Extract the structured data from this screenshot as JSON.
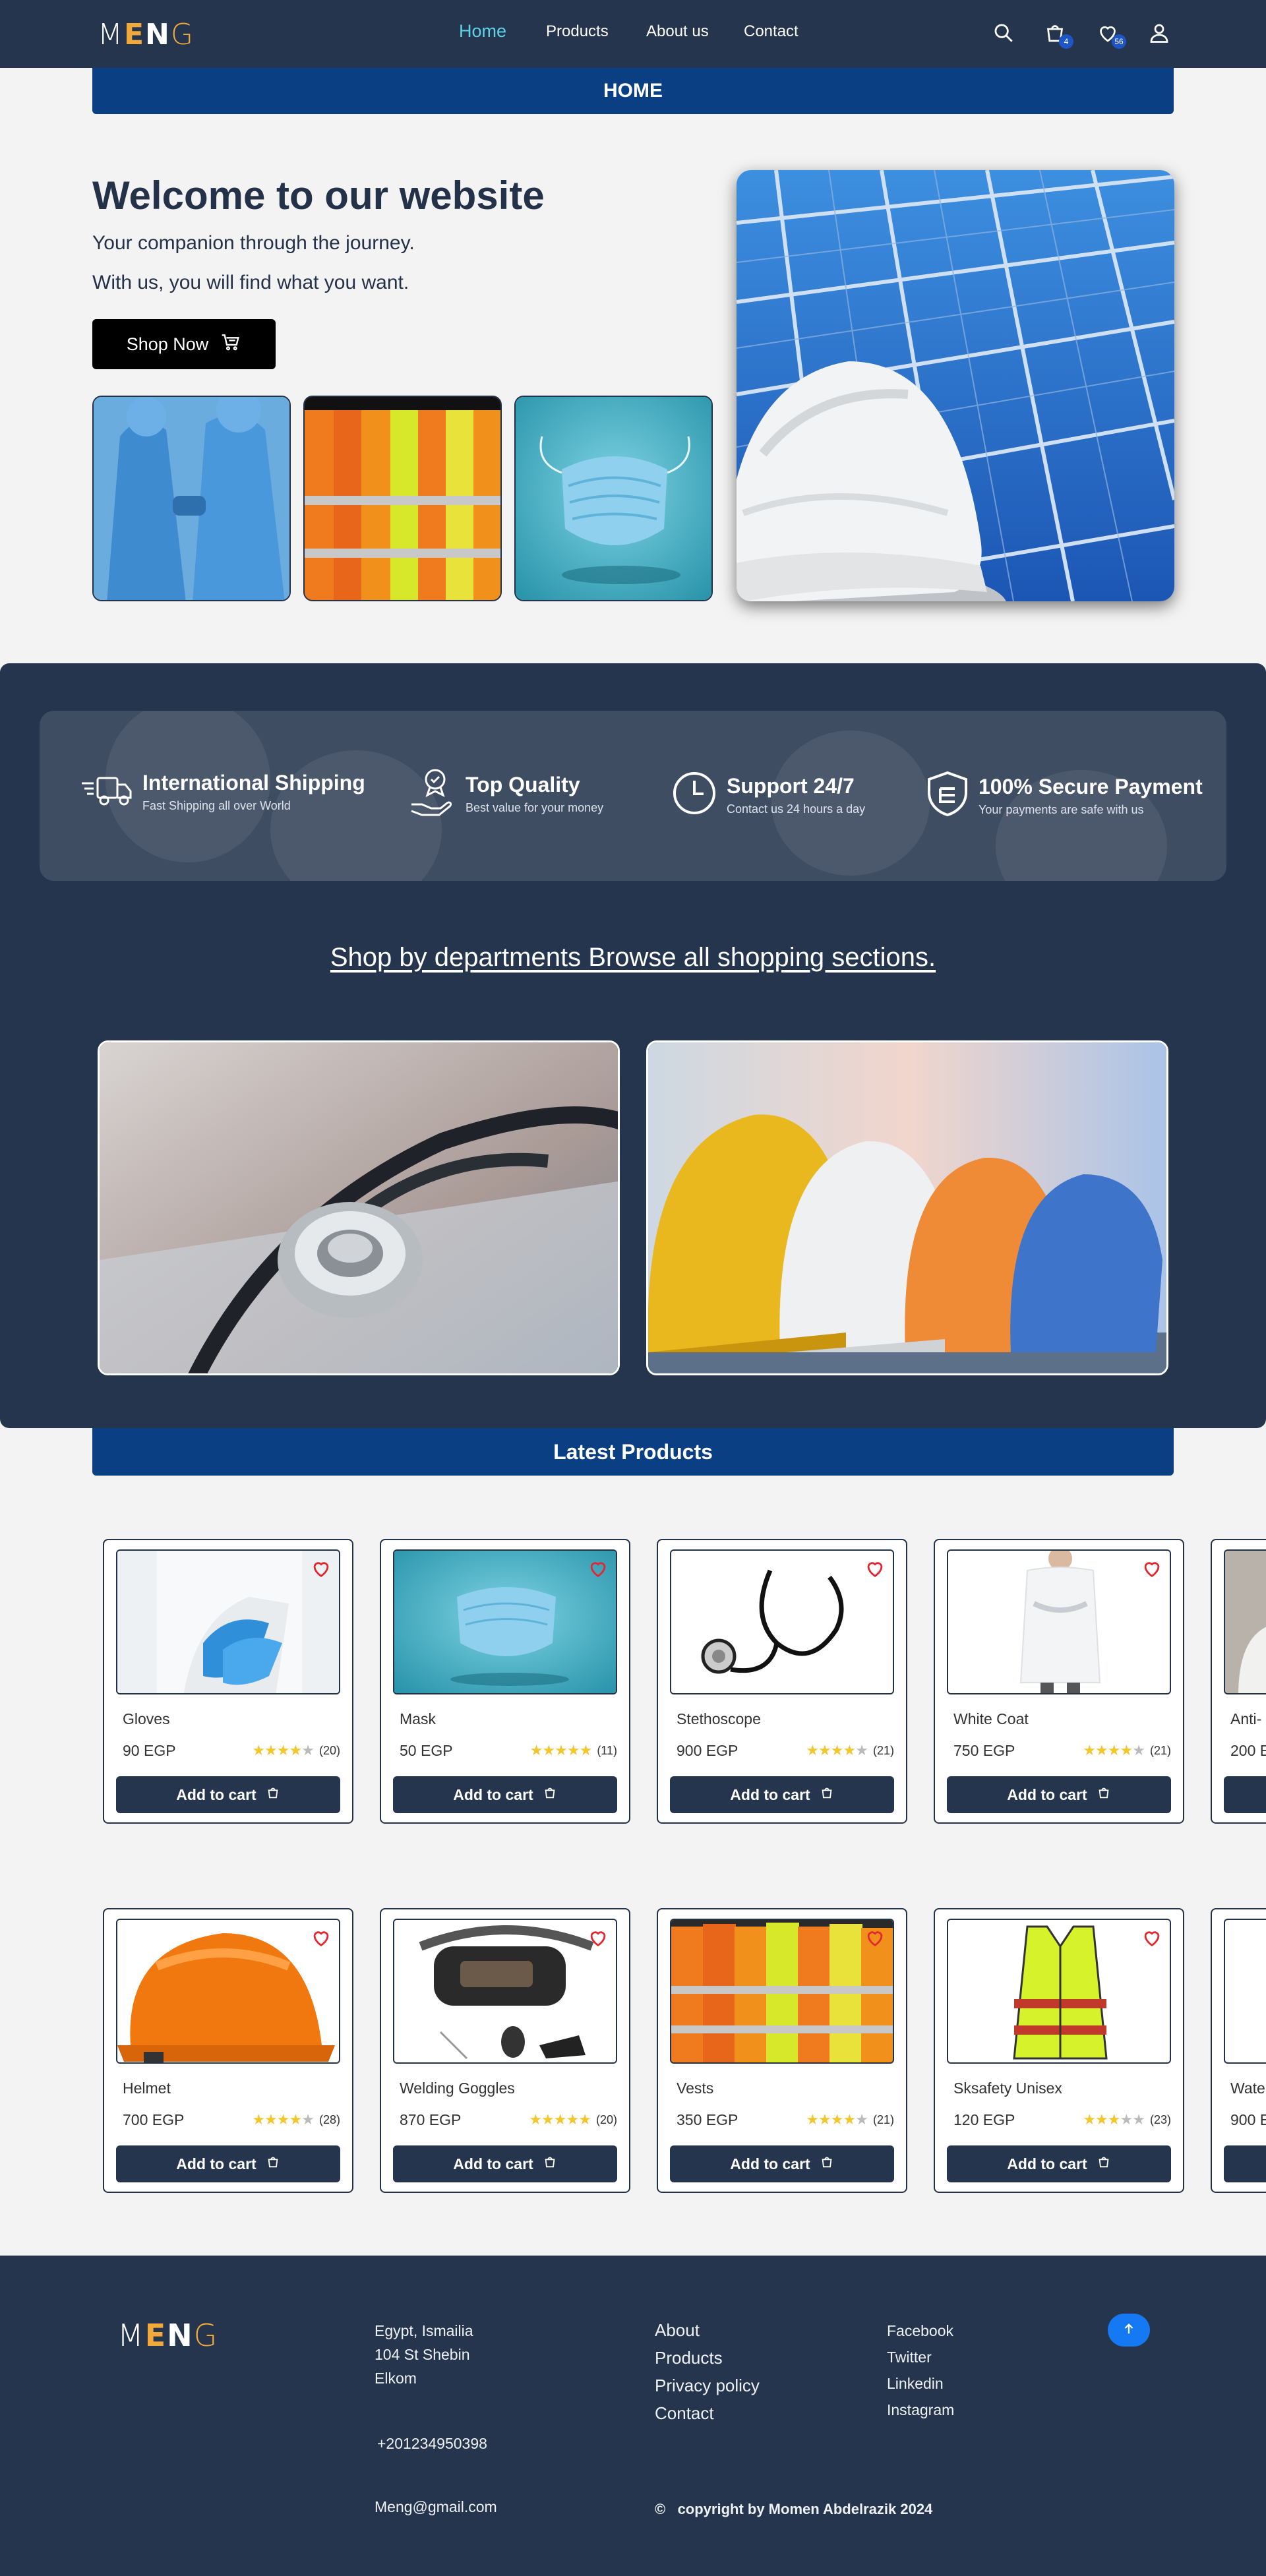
{
  "nav": {
    "logo": [
      "M",
      "E",
      "N",
      "G"
    ],
    "links": [
      "Home",
      "Products",
      "About us",
      "Contact"
    ],
    "cart_count": "4",
    "wishlist_count": "56",
    "icons": [
      "search-icon",
      "cart-icon",
      "heart-icon",
      "user-icon"
    ]
  },
  "home_bar": "HOME",
  "hero": {
    "title": "Welcome  to our website",
    "sub1": "Your companion through the journey.",
    "sub2": "With us, you will find what you want.",
    "shop_now": "Shop Now",
    "images": [
      "protective-suits-photo",
      "safety-vests-photo",
      "face-mask-photo"
    ],
    "main_image": "helmet-on-solar-panel-photo"
  },
  "features": [
    {
      "title": "International  Shipping",
      "sub": "Fast Shipping all over World",
      "icon": "truck-icon"
    },
    {
      "title": "Top Quality",
      "sub": "Best value for your money",
      "icon": "quality-icon"
    },
    {
      "title": "Support 24/7",
      "sub": "Contact us 24 hours a day",
      "icon": "clock-icon"
    },
    {
      "title": "100% Secure Payment",
      "sub": "Your payments are safe with us",
      "icon": "shield-icon"
    }
  ],
  "departments": {
    "title": "Shop by departments  Browse all shopping sections.",
    "cards": [
      "medical-department-photo",
      "safety-helmets-department-photo"
    ]
  },
  "latest_bar": "Latest Products",
  "products_row1": [
    {
      "name": "Gloves",
      "price": "90 EGP",
      "rating": 3.5,
      "count": "(20)"
    },
    {
      "name": "Mask",
      "price": "50 EGP",
      "rating": 5,
      "count": "(11)"
    },
    {
      "name": "Stethoscope",
      "price": "900 EGP",
      "rating": 4,
      "count": "(21)"
    },
    {
      "name": "White Coat",
      "price": "750 EGP",
      "rating": 4,
      "count": "(21)"
    },
    {
      "name": "Anti-",
      "price": "200 E"
    }
  ],
  "products_row2": [
    {
      "name": "Helmet",
      "price": "700 EGP",
      "rating": 4,
      "count": "(28)"
    },
    {
      "name": "Welding Goggles",
      "price": "870 EGP",
      "rating": 5,
      "count": "(20)"
    },
    {
      "name": "Vests",
      "price": "350 EGP",
      "rating": 4,
      "count": "(21)"
    },
    {
      "name": "Sksafety Unisex",
      "price": "120 EGP",
      "rating": 3,
      "count": "(23)"
    },
    {
      "name": "Wate",
      "price": "900 E"
    }
  ],
  "add_to_cart": "Add to cart",
  "footer": {
    "logo": [
      "M",
      "E",
      "N",
      "G"
    ],
    "address": [
      "Egypt, Ismailia",
      "104 St Shebin",
      "Elkom"
    ],
    "phone": "+201234950398",
    "email": "Meng@gmail.com",
    "links": [
      "About",
      "Products",
      "Privacy policy",
      "Contact"
    ],
    "social": [
      "Facebook",
      "Twitter",
      "Linkedin",
      "Instagram"
    ],
    "copyright_symbol": "©",
    "copyright": "copyright by Momen Abdelrazik 2024"
  },
  "colors": {
    "navy": "#25354d",
    "blue_bar": "#0a3f83",
    "accent_active": "#5fd3e8",
    "logo_orange": "#f2a93b",
    "star": "#f3c62e",
    "heart": "#e3262f",
    "up_button": "#1479f2"
  }
}
